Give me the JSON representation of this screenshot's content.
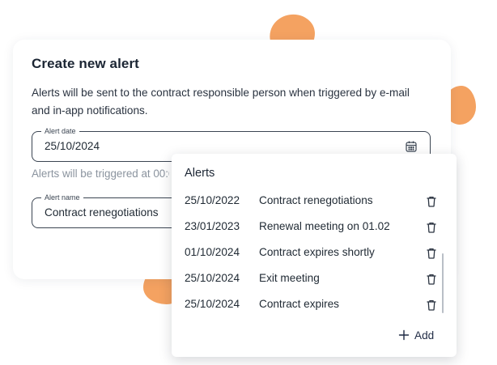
{
  "colors": {
    "accent_blob": "#f4a261",
    "text_primary": "#1f2933",
    "text_muted": "#8a939e",
    "border": "#3b4552"
  },
  "create_alert_card": {
    "title": "Create new alert",
    "description": "Alerts will be sent to the contract responsible person when triggered by e-mail and in-app notifications.",
    "alert_date_field": {
      "label": "Alert date",
      "value": "25/10/2024",
      "icon": "calendar-icon"
    },
    "helper_text": "Alerts will be triggered at 00:00",
    "alert_name_field": {
      "label": "Alert name",
      "value": "Contract renegotiations"
    }
  },
  "alerts_panel": {
    "title": "Alerts",
    "items": [
      {
        "date": "25/10/2022",
        "name": "Contract renegotiations",
        "icon": "trash-icon"
      },
      {
        "date": "23/01/2023",
        "name": "Renewal meeting on 01.02",
        "icon": "trash-icon"
      },
      {
        "date": "01/10/2024",
        "name": "Contract expires shortly",
        "icon": "trash-icon"
      },
      {
        "date": "25/10/2024",
        "name": "Exit meeting",
        "icon": "trash-icon"
      },
      {
        "date": "25/10/2024",
        "name": "Contract expires",
        "icon": "trash-icon"
      }
    ],
    "add_label": "Add",
    "add_icon": "plus-icon"
  }
}
